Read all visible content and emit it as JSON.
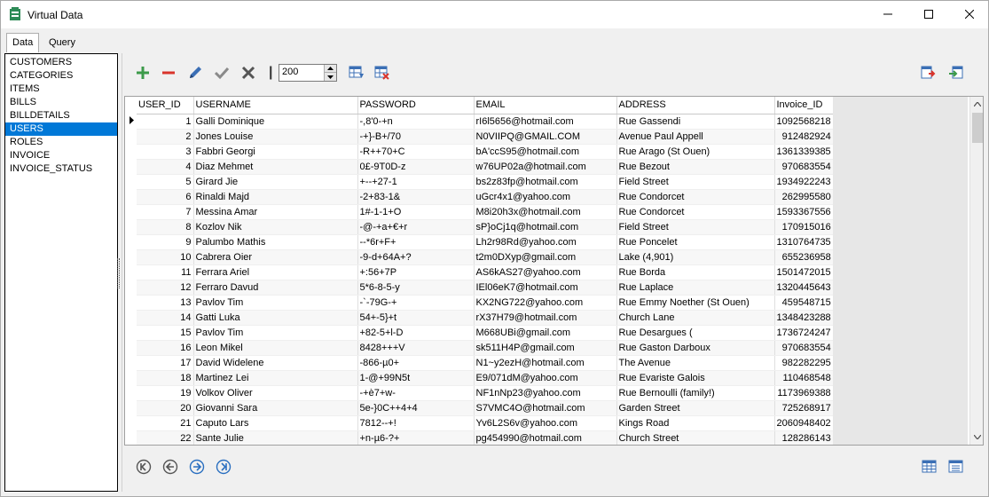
{
  "window": {
    "title": "Virtual Data"
  },
  "tabs": [
    {
      "label": "Data"
    },
    {
      "label": "Query"
    }
  ],
  "tables": {
    "items": [
      "CUSTOMERS",
      "CATEGORIES",
      "ITEMS",
      "BILLS",
      "BILLDETAILS",
      "USERS",
      "ROLES",
      "INVOICE",
      "INVOICE_STATUS"
    ],
    "selected": "USERS"
  },
  "toolbar": {
    "page_size": "200"
  },
  "grid": {
    "columns": [
      "USER_ID",
      "USERNAME",
      "PASSWORD",
      "EMAIL",
      "ADDRESS",
      "Invoice_ID"
    ],
    "rows": [
      [
        "1",
        "Galli Dominique",
        "-,8'0-+n",
        "rI6l5656@hotmail.com",
        "Rue Gassendi",
        "1092568218"
      ],
      [
        "2",
        "Jones Louise",
        "-+}-B+/70",
        "N0VIIPQ@GMAIL.COM",
        "Avenue Paul Appell",
        "912482924"
      ],
      [
        "3",
        "Fabbri Georgi",
        "-R++70+C",
        "bA'ccS95@hotmail.com",
        "Rue Arago (St Ouen)",
        "1361339385"
      ],
      [
        "4",
        "Diaz Mehmet",
        "0£-9T0D-z",
        "w76UP02a@hotmail.com",
        "Rue Bezout",
        "970683554"
      ],
      [
        "5",
        "Girard Jie",
        "+--+27-1",
        "bs2z83fp@hotmail.com",
        "Field Street",
        "1934922243"
      ],
      [
        "6",
        "Rinaldi Majd",
        "-2+83-1&",
        "uGcr4x1@yahoo.com",
        "Rue Condorcet",
        "262995580"
      ],
      [
        "7",
        "Messina Amar",
        "1#-1-1+O",
        "M8i20h3x@hotmail.com",
        "Rue Condorcet",
        "1593367556"
      ],
      [
        "8",
        "Kozlov Nik",
        "-@-+a+€+r",
        "sP}oCj1q@hotmail.com",
        "Field Street",
        "170915016"
      ],
      [
        "9",
        "Palumbo Mathis",
        "--*6r+F+",
        "Lh2r98Rd@yahoo.com",
        "Rue Poncelet",
        "1310764735"
      ],
      [
        "10",
        "Cabrera Oier",
        "-9-d+64A+?",
        "t2m0DXyp@gmail.com",
        "Lake (4,901)",
        "655236958"
      ],
      [
        "11",
        "Ferrara Ariel",
        "+:56+7P",
        "AS6kAS27@yahoo.com",
        "Rue Borda",
        "1501472015"
      ],
      [
        "12",
        "Ferraro Davud",
        "5*6-8-5-y",
        "IEl06eK7@hotmail.com",
        "Rue Laplace",
        "1320445643"
      ],
      [
        "13",
        "Pavlov Tim",
        "-`-79G-+",
        "KX2NG722@yahoo.com",
        "Rue Emmy Noether (St Ouen)",
        "459548715"
      ],
      [
        "14",
        "Gatti Luka",
        "54+-5}+t",
        "rX37H79@hotmail.com",
        "Church Lane",
        "1348423288"
      ],
      [
        "15",
        "Pavlov Tim",
        "+82-5+l-D",
        "M668UBi@gmail.com",
        "Rue Desargues (",
        "1736724247"
      ],
      [
        "16",
        "Leon Mikel",
        "8428+++V",
        "sk511H4P@gmail.com",
        "Rue Gaston Darboux",
        "970683554"
      ],
      [
        "17",
        "David Widelene",
        "-866-µ0+",
        "N1~y2ezH@hotmail.com",
        "The Avenue",
        "982282295"
      ],
      [
        "18",
        "Martinez Lei",
        "1-@+99N5t",
        "E9/071dM@yahoo.com",
        "Rue Evariste Galois",
        "110468548"
      ],
      [
        "19",
        "Volkov Oliver",
        "-+è7+w-",
        "NF1nNp23@yahoo.com",
        "Rue Bernoulli (family!)",
        "1173969388"
      ],
      [
        "20",
        "Giovanni Sara",
        "5e-}0C++4+4",
        "S7VMC4O@hotmail.com",
        "Garden Street",
        "725268917"
      ],
      [
        "21",
        "Caputo Lars",
        "7812--+!",
        "Yv6L2S6v@yahoo.com",
        "Kings Road",
        "2060948402"
      ],
      [
        "22",
        "Sante Julie",
        "+n-µ6-?+",
        "pg454990@hotmail.com",
        "Church Street",
        "128286143"
      ]
    ]
  },
  "colors": {
    "selection": "#0078d7",
    "add": "#3c9a4a",
    "remove": "#d9342b",
    "edit": "#3b6fb5"
  }
}
